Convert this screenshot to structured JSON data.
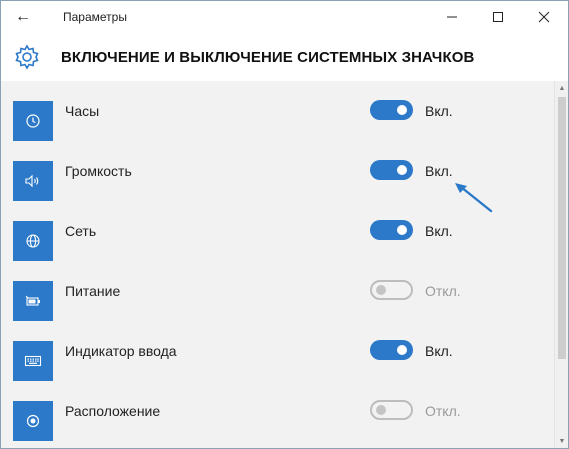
{
  "window": {
    "app_title": "Параметры",
    "back_icon": "←",
    "minimize_icon": "—",
    "maximize_icon": "☐",
    "close_icon": "✕"
  },
  "header": {
    "title": "ВКЛЮЧЕНИЕ И ВЫКЛЮЧЕНИЕ СИСТЕМНЫХ ЗНАЧКОВ",
    "icon": "gear-icon"
  },
  "rows": [
    {
      "label": "Часы",
      "icon": "clock-icon",
      "state": "on",
      "state_label": "Вкл."
    },
    {
      "label": "Громкость",
      "icon": "volume-icon",
      "state": "on",
      "state_label": "Вкл."
    },
    {
      "label": "Сеть",
      "icon": "network-globe-icon",
      "state": "on",
      "state_label": "Вкл."
    },
    {
      "label": "Питание",
      "icon": "battery-icon",
      "state": "off",
      "state_label": "Откл."
    },
    {
      "label": "Индикатор ввода",
      "icon": "keyboard-icon",
      "state": "on",
      "state_label": "Вкл."
    },
    {
      "label": "Расположение",
      "icon": "location-icon",
      "state": "off",
      "state_label": "Откл."
    }
  ],
  "colors": {
    "accent": "#2b79c8",
    "content_bg": "#f2f2f2",
    "off_text": "#9a9a9a"
  },
  "scrollbar": {
    "up_icon": "▲",
    "down_icon": "▼"
  }
}
